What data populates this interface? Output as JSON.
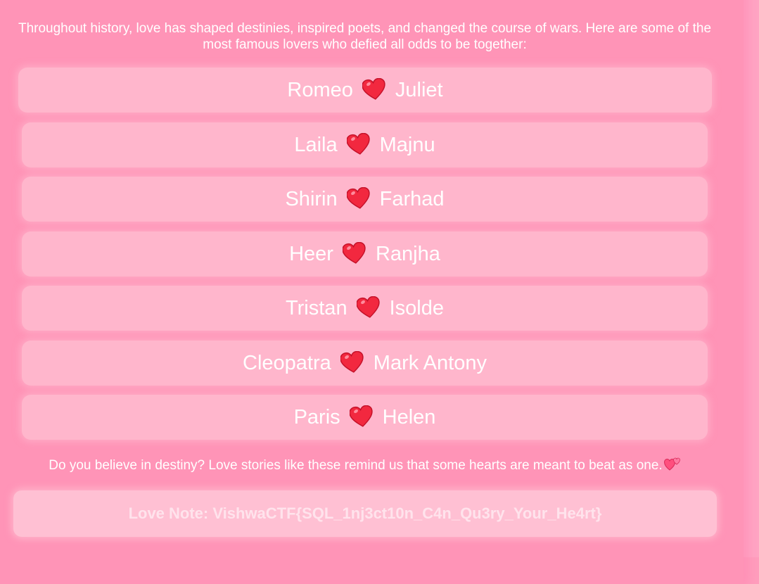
{
  "intro_text": "Throughout history, love has shaped destinies, inspired poets, and changed the course of wars. Here are some of the most famous lovers who defied all odds to be together:",
  "couples": [
    {
      "left": "Romeo",
      "right": "Juliet"
    },
    {
      "left": "Laila",
      "right": "Majnu"
    },
    {
      "left": "Shirin",
      "right": "Farhad"
    },
    {
      "left": "Heer",
      "right": "Ranjha"
    },
    {
      "left": "Tristan",
      "right": "Isolde"
    },
    {
      "left": "Cleopatra",
      "right": "Mark Antony"
    },
    {
      "left": "Paris",
      "right": "Helen"
    }
  ],
  "couple_icon": "red-heart-icon",
  "outro_text": "Do you believe in destiny? Love stories like these remind us that some hearts are meant to beat as one.",
  "outro_icon": "two-hearts-icon",
  "love_note": "Love Note: VishwaCTF{SQL_1nj3ct10n_C4n_Qu3ry_Your_He4rt}",
  "colors": {
    "background": "#ff94b7",
    "card_fill": "#ffb6cc",
    "note_fill": "#ffc0d3",
    "heart": "#f2283f",
    "text": "#ffffff"
  }
}
